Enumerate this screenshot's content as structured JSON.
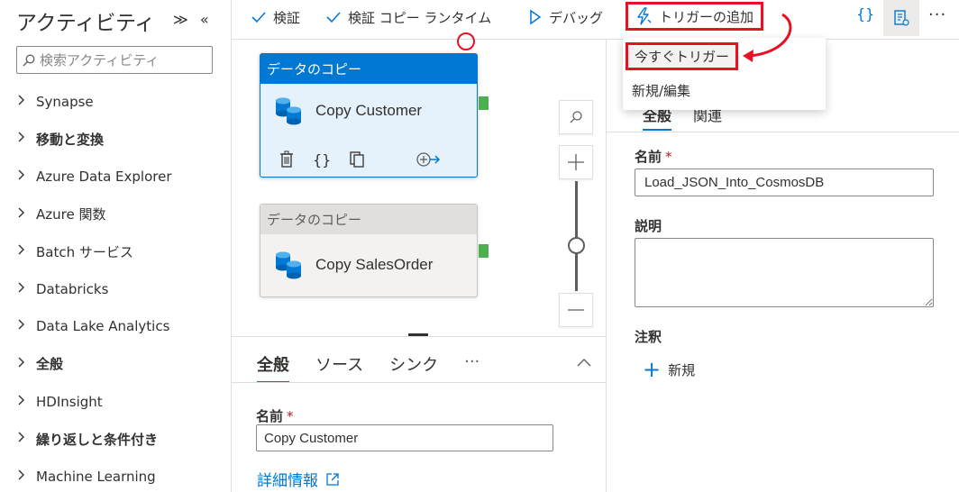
{
  "left_panel": {
    "title": "アクティビティ",
    "collapse_label": "≫",
    "hide_label": "«",
    "search_placeholder": "検索アクティビティ",
    "categories": [
      {
        "label": "Synapse",
        "bold": false
      },
      {
        "label": "移動と変換",
        "bold": true
      },
      {
        "label": "Azure Data Explorer",
        "bold": false
      },
      {
        "label": "Azure 関数",
        "bold": false
      },
      {
        "label": "Batch サービス",
        "bold": false
      },
      {
        "label": "Databricks",
        "bold": false
      },
      {
        "label": "Data Lake Analytics",
        "bold": false
      },
      {
        "label": "全般",
        "bold": true
      },
      {
        "label": "HDInsight",
        "bold": false
      },
      {
        "label": "繰り返しと条件付き",
        "bold": true
      },
      {
        "label": "Machine Learning",
        "bold": false
      }
    ]
  },
  "toolbar": {
    "validate": "検証",
    "validate_copy_runtime": "検証 コピー ランタイム",
    "debug": "デバッグ",
    "add_trigger": "トリガーの追加",
    "code_icon": "{}",
    "more": "···"
  },
  "trigger_menu": {
    "trigger_now": "今すぐトリガー",
    "new_edit": "新規/編集"
  },
  "canvas": {
    "activities": [
      {
        "type": "データのコピー",
        "name": "Copy Customer"
      },
      {
        "type": "データのコピー",
        "name": "Copy SalesOrder"
      }
    ],
    "action_code": "{}"
  },
  "bottom_panel": {
    "tabs": [
      "全般",
      "ソース",
      "シンク"
    ],
    "more": "···",
    "name_label": "名前",
    "required_mark": "*",
    "name_value": "Copy Customer",
    "learn_more": "詳細情報"
  },
  "right_panel": {
    "tabs": [
      "全般",
      "関連"
    ],
    "name_label": "名前",
    "required_mark": "*",
    "name_value": "Load_JSON_Into_CosmosDB",
    "description_label": "説明",
    "description_value": "",
    "annotations_label": "注釈",
    "new_label": "新規"
  },
  "colors": {
    "accent": "#0078d4",
    "highlight": "#e81123",
    "port": "#4caf50"
  }
}
